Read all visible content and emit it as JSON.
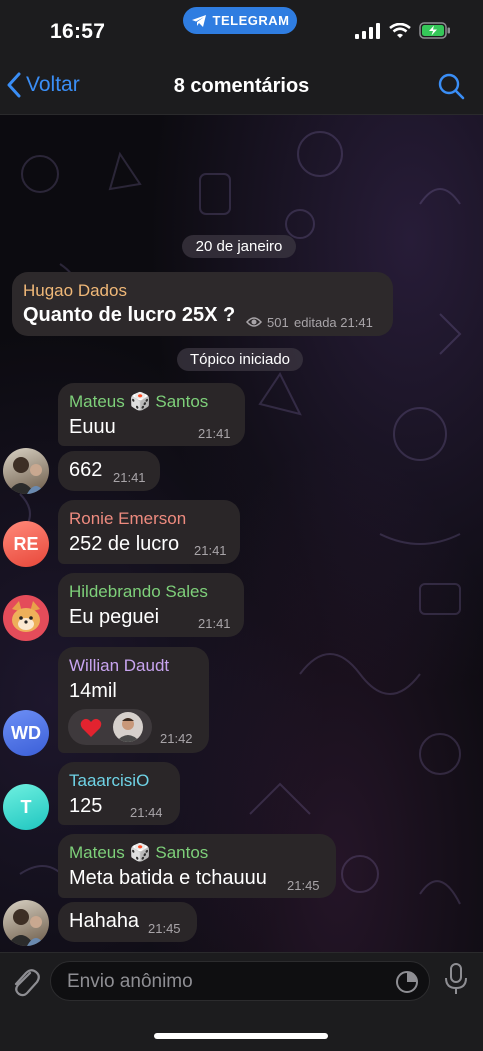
{
  "status_bar": {
    "time": "16:57",
    "app_pill": "TELEGRAM"
  },
  "nav": {
    "back_label": "Voltar",
    "title": "8 comentários"
  },
  "chat": {
    "date_divider": "20 de janeiro",
    "pinned_post": {
      "author": "Hugao Dados",
      "text": "Quanto de lucro 25X ?",
      "views": "501",
      "meta": "editada 21:41"
    },
    "topic_started": "Tópico iniciado",
    "messages": [
      {
        "sender": "Mateus 🎲 Santos",
        "sender_color": "#7ed07a",
        "text": "Euuu",
        "time": "21:41"
      },
      {
        "text": "662",
        "time": "21:41"
      },
      {
        "sender": "Ronie Emerson",
        "sender_color": "#ee8b7f",
        "text": "252 de lucro",
        "time": "21:41",
        "avatar_initials": "RE"
      },
      {
        "sender": "Hildebrando Sales",
        "sender_color": "#7ed07a",
        "text": "Eu peguei",
        "time": "21:41"
      },
      {
        "sender": "Willian Daudt",
        "sender_color": "#c8a4f0",
        "text": "14mil",
        "time": "21:42",
        "avatar_initials": "WD",
        "reaction": "❤️"
      },
      {
        "sender": "TaaarcisiO",
        "sender_color": "#6fd3e6",
        "text": "125",
        "time": "21:44",
        "avatar_initials": "T"
      },
      {
        "sender": "Mateus 🎲 Santos",
        "sender_color": "#7ed07a",
        "text": "Meta batida e tchauuu",
        "time": "21:45"
      },
      {
        "text": "Hahaha",
        "time": "21:45"
      }
    ]
  },
  "input": {
    "placeholder": "Envio anônimo"
  },
  "colors": {
    "accent": "#3a8ef6",
    "bubble": "#2a2628",
    "pinned_author": "#f0b878"
  }
}
